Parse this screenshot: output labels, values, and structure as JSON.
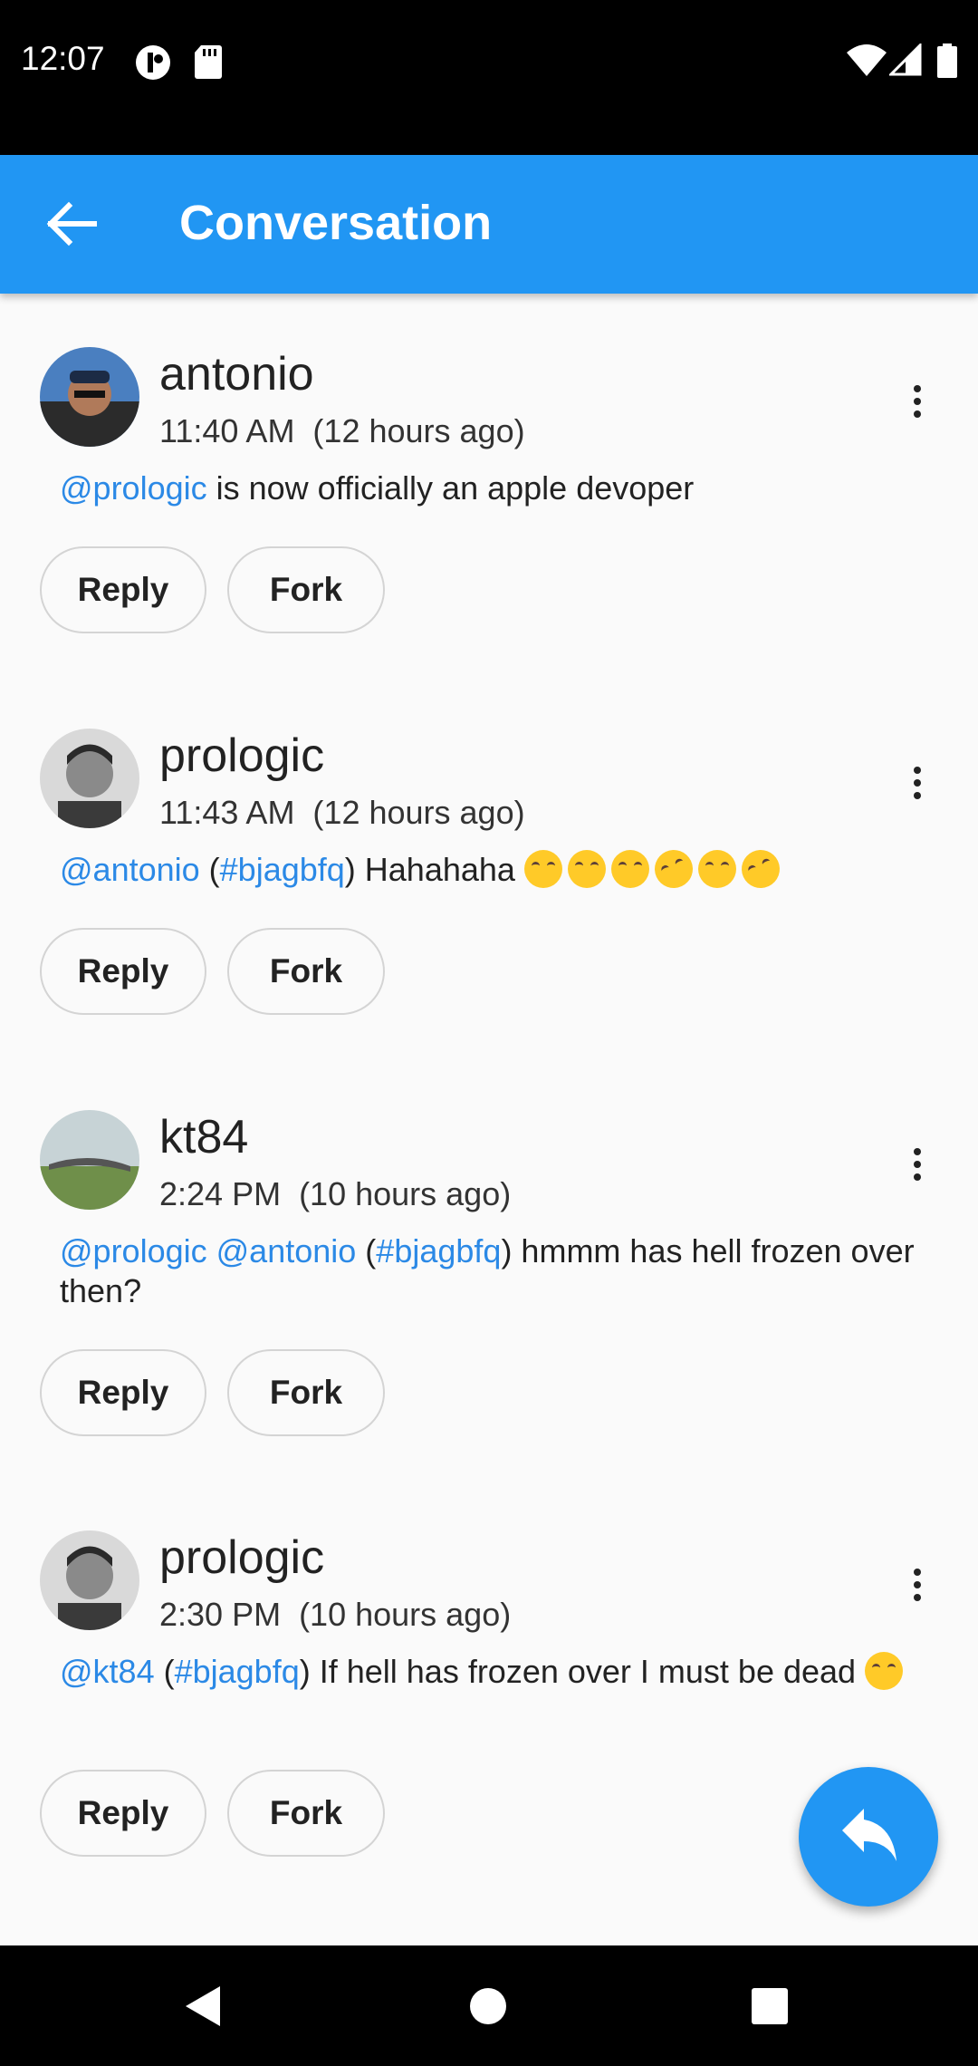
{
  "status_bar": {
    "time": "12:07"
  },
  "app_bar": {
    "title": "Conversation"
  },
  "posts": [
    {
      "author": "antonio",
      "time": "11:40 AM  (12 hours ago)",
      "content": [
        {
          "type": "mention",
          "text": "@prologic"
        },
        {
          "type": "text",
          "text": " is now officially an apple devoper"
        }
      ],
      "reply_label": "Reply",
      "fork_label": "Fork"
    },
    {
      "author": "prologic",
      "time": "11:43 AM  (12 hours ago)",
      "content": [
        {
          "type": "mention",
          "text": "@antonio"
        },
        {
          "type": "text",
          "text": " ("
        },
        {
          "type": "mention",
          "text": "#bjagbfq"
        },
        {
          "type": "text",
          "text": ") Hahahaha "
        },
        {
          "type": "emoji",
          "text": "😂"
        },
        {
          "type": "emoji",
          "text": "😳"
        },
        {
          "type": "emoji",
          "text": "😂"
        },
        {
          "type": "emoji",
          "text": "🤣"
        },
        {
          "type": "emoji",
          "text": "😂"
        },
        {
          "type": "emoji",
          "text": "🤣"
        }
      ],
      "reply_label": "Reply",
      "fork_label": "Fork"
    },
    {
      "author": "kt84",
      "time": "2:24 PM  (10 hours ago)",
      "content": [
        {
          "type": "mention",
          "text": "@prologic"
        },
        {
          "type": "text",
          "text": " "
        },
        {
          "type": "mention",
          "text": "@antonio"
        },
        {
          "type": "text",
          "text": " ("
        },
        {
          "type": "mention",
          "text": "#bjagbfq"
        },
        {
          "type": "text",
          "text": ") hmmm has hell frozen over then?"
        }
      ],
      "reply_label": "Reply",
      "fork_label": "Fork"
    },
    {
      "author": "prologic",
      "time": "2:30 PM  (10 hours ago)",
      "content": [
        {
          "type": "mention",
          "text": "@kt84"
        },
        {
          "type": "text",
          "text": " ("
        },
        {
          "type": "mention",
          "text": "#bjagbfq"
        },
        {
          "type": "text",
          "text": ") If hell has frozen over I must be dead "
        },
        {
          "type": "emoji",
          "text": "😂"
        }
      ],
      "reply_label": "Reply",
      "fork_label": "Fork"
    }
  ],
  "colors": {
    "accent": "#2196f3",
    "link": "#2b89e6"
  }
}
